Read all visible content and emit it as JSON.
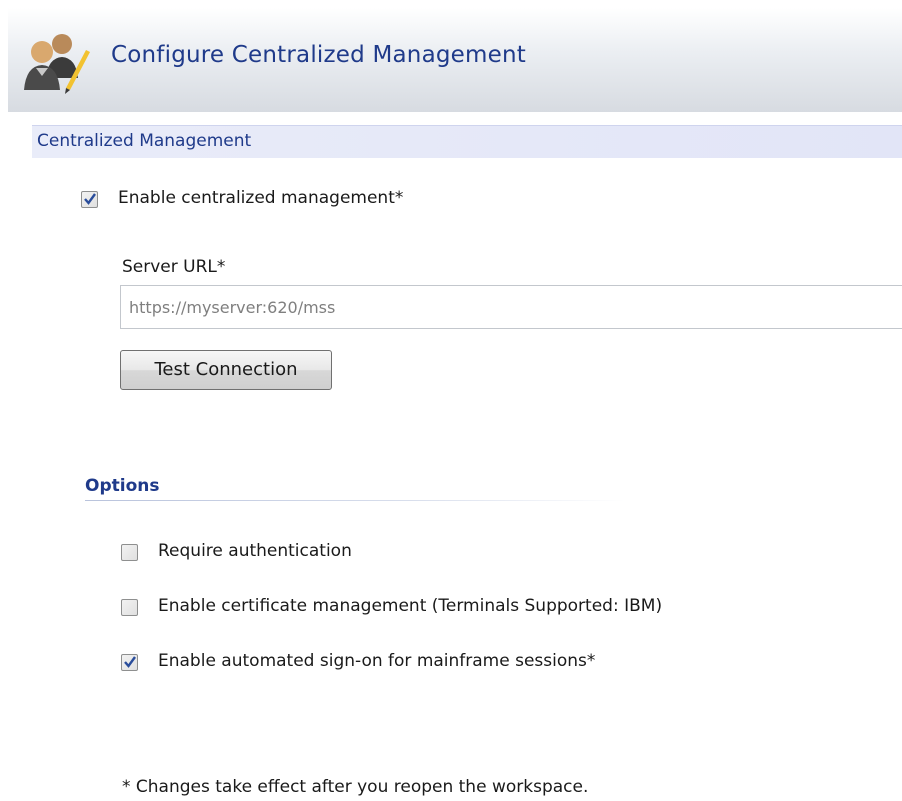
{
  "header": {
    "title": "Configure Centralized Management",
    "icon": "users-pencil-icon"
  },
  "section": {
    "title": "Centralized Management"
  },
  "enable_centralized": {
    "label": "Enable centralized management*",
    "checked": true
  },
  "server_url": {
    "label": "Server URL*",
    "value": "https://myserver:620/mss"
  },
  "test_button": {
    "label": "Test Connection"
  },
  "options": {
    "title": "Options",
    "items": [
      {
        "label": "Require authentication",
        "checked": false
      },
      {
        "label": "Enable certificate management (Terminals Supported: IBM)",
        "checked": false
      },
      {
        "label": "Enable automated sign-on for mainframe sessions*",
        "checked": true
      }
    ]
  },
  "footnote": "* Changes take effect after you reopen the workspace.",
  "colors": {
    "accent": "#1f3a8a",
    "check": "#2a4d9b"
  }
}
